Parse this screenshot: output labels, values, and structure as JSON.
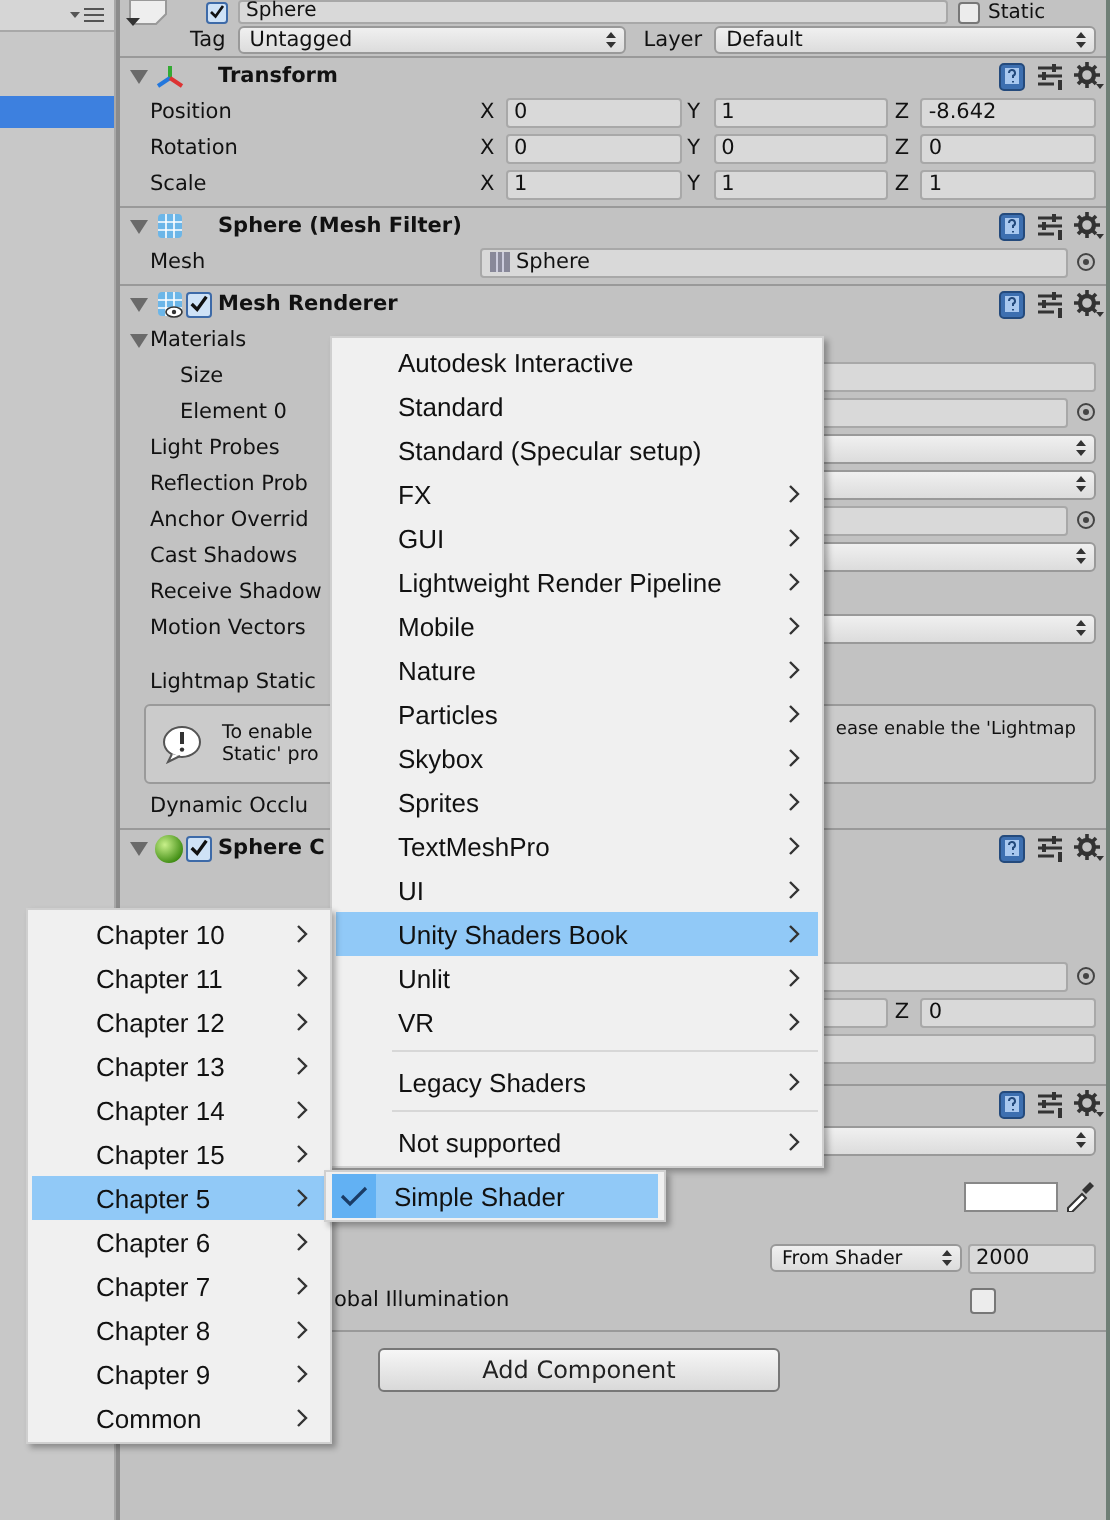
{
  "hierarchy": {
    "rows": [
      {
        "selected": false
      },
      {
        "selected": false
      },
      {
        "selected": true
      }
    ]
  },
  "object": {
    "active": true,
    "name": "Sphere",
    "static_label": "Static",
    "static": false,
    "tag_label": "Tag",
    "tag": "Untagged",
    "layer_label": "Layer",
    "layer": "Default"
  },
  "components": [
    {
      "kind": "transform",
      "title": "Transform",
      "expanded": true,
      "rows": [
        {
          "kind": "vector",
          "label": "Position",
          "values": [
            {
              "axis": "X",
              "value": "0"
            },
            {
              "axis": "Y",
              "value": "1"
            },
            {
              "axis": "Z",
              "value": "-8.642"
            }
          ]
        },
        {
          "kind": "vector",
          "label": "Rotation",
          "values": [
            {
              "axis": "X",
              "value": "0"
            },
            {
              "axis": "Y",
              "value": "0"
            },
            {
              "axis": "Z",
              "value": "0"
            }
          ]
        },
        {
          "kind": "vector",
          "label": "Scale",
          "values": [
            {
              "axis": "X",
              "value": "1"
            },
            {
              "axis": "Y",
              "value": "1"
            },
            {
              "axis": "Z",
              "value": "1"
            }
          ]
        }
      ]
    },
    {
      "kind": "mesh_filter",
      "title": "Sphere (Mesh Filter)",
      "expanded": true,
      "rows": [
        {
          "kind": "object",
          "label": "Mesh",
          "value": "Sphere"
        }
      ]
    },
    {
      "kind": "mesh_renderer",
      "title": "Mesh Renderer",
      "enabled": true,
      "expanded": true,
      "rows": [
        {
          "kind": "foldout",
          "label": "Materials",
          "expanded": true
        },
        {
          "kind": "field",
          "label": "Size",
          "indent": true
        },
        {
          "kind": "object",
          "label": "Element 0",
          "indent": true
        },
        {
          "kind": "dropdown",
          "label": "Light Probes"
        },
        {
          "kind": "dropdown",
          "label": "Reflection Prob"
        },
        {
          "kind": "object",
          "label": "Anchor Overrid"
        },
        {
          "kind": "dropdown",
          "label": "Cast Shadows"
        },
        {
          "kind": "label",
          "label": "Receive Shadow"
        },
        {
          "kind": "dropdown",
          "label": "Motion Vectors"
        },
        {
          "kind": "label",
          "label": "Lightmap Static",
          "gap": true
        },
        {
          "kind": "help",
          "left_lines": [
            "To enable",
            "Static' pro"
          ],
          "right_text": "ease enable the 'Lightmap"
        },
        {
          "kind": "label",
          "label": "Dynamic Occlu"
        }
      ]
    },
    {
      "kind": "collider",
      "title": "Sphere C",
      "enabled": true,
      "expanded": true,
      "rows": [
        {
          "kind": "object"
        },
        {
          "kind": "vector",
          "values": [
            {
              "axis": "Z",
              "value": "0"
            }
          ]
        },
        {
          "kind": "field"
        }
      ]
    },
    {
      "kind": "material",
      "rows": [
        {
          "kind": "dropdown"
        },
        {
          "kind": "color"
        },
        {
          "kind": "queue",
          "dropdown": "From Shader",
          "value": "2000"
        },
        {
          "kind": "checkbox",
          "label": "obal Illumination",
          "checked": false
        }
      ]
    }
  ],
  "add_component": "Add Component",
  "menus": [
    {
      "items": [
        {
          "kind": "item",
          "label": "Autodesk Interactive",
          "submenu": false,
          "selected": false
        },
        {
          "kind": "item",
          "label": "Standard",
          "submenu": false,
          "selected": false
        },
        {
          "kind": "item",
          "label": "Standard (Specular setup)",
          "submenu": false,
          "selected": false
        },
        {
          "kind": "item",
          "label": "FX",
          "submenu": true,
          "selected": false
        },
        {
          "kind": "item",
          "label": "GUI",
          "submenu": true,
          "selected": false
        },
        {
          "kind": "item",
          "label": "Lightweight Render Pipeline",
          "submenu": true,
          "selected": false
        },
        {
          "kind": "item",
          "label": "Mobile",
          "submenu": true,
          "selected": false
        },
        {
          "kind": "item",
          "label": "Nature",
          "submenu": true,
          "selected": false
        },
        {
          "kind": "item",
          "label": "Particles",
          "submenu": true,
          "selected": false
        },
        {
          "kind": "item",
          "label": "Skybox",
          "submenu": true,
          "selected": false
        },
        {
          "kind": "item",
          "label": "Sprites",
          "submenu": true,
          "selected": false
        },
        {
          "kind": "item",
          "label": "TextMeshPro",
          "submenu": true,
          "selected": false
        },
        {
          "kind": "item",
          "label": "UI",
          "submenu": true,
          "selected": false
        },
        {
          "kind": "item",
          "label": "Unity Shaders Book",
          "submenu": true,
          "selected": true
        },
        {
          "kind": "item",
          "label": "Unlit",
          "submenu": true,
          "selected": false
        },
        {
          "kind": "item",
          "label": "VR",
          "submenu": true,
          "selected": false
        },
        {
          "kind": "separator"
        },
        {
          "kind": "item",
          "label": "Legacy Shaders",
          "submenu": true,
          "selected": false
        },
        {
          "kind": "separator"
        },
        {
          "kind": "item",
          "label": "Not supported",
          "submenu": true,
          "selected": false
        }
      ]
    },
    {
      "items": [
        {
          "kind": "item",
          "label": "Chapter 10",
          "submenu": true,
          "selected": false
        },
        {
          "kind": "item",
          "label": "Chapter 11",
          "submenu": true,
          "selected": false
        },
        {
          "kind": "item",
          "label": "Chapter 12",
          "submenu": true,
          "selected": false
        },
        {
          "kind": "item",
          "label": "Chapter 13",
          "submenu": true,
          "selected": false
        },
        {
          "kind": "item",
          "label": "Chapter 14",
          "submenu": true,
          "selected": false
        },
        {
          "kind": "item",
          "label": "Chapter 15",
          "submenu": true,
          "selected": false
        },
        {
          "kind": "item",
          "label": "Chapter 5",
          "submenu": true,
          "selected": true
        },
        {
          "kind": "item",
          "label": "Chapter 6",
          "submenu": true,
          "selected": false
        },
        {
          "kind": "item",
          "label": "Chapter 7",
          "submenu": true,
          "selected": false
        },
        {
          "kind": "item",
          "label": "Chapter 8",
          "submenu": true,
          "selected": false
        },
        {
          "kind": "item",
          "label": "Chapter 9",
          "submenu": true,
          "selected": false
        },
        {
          "kind": "item",
          "label": "Common",
          "submenu": true,
          "selected": false
        }
      ]
    },
    {
      "items": [
        {
          "kind": "item",
          "label": "Simple Shader",
          "submenu": false,
          "selected": true,
          "checked": true
        }
      ]
    }
  ]
}
